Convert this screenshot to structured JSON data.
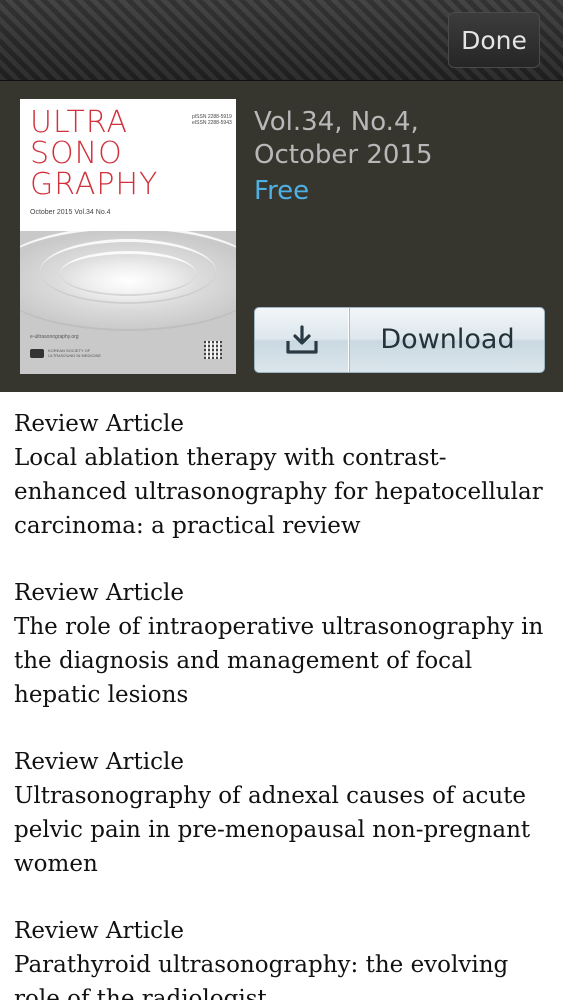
{
  "nav": {
    "done_label": "Done"
  },
  "issue": {
    "cover": {
      "title_lines": [
        "ULTRA",
        "SONO",
        "GRAPHY"
      ],
      "issn_lines": [
        "pISSN 2288-5919",
        "eISSN 2288-5943"
      ],
      "subtitle": "October 2015  Vol.34  No.4",
      "url": "e-ultrasonography.org",
      "society_lines": [
        "KOREAN SOCIETY OF",
        "ULTRASOUND IN MEDICINE"
      ],
      "title_color": "#d1313c"
    },
    "volume_line": "Vol.34, No.4,",
    "date_line": "October 2015",
    "price": "Free",
    "price_color": "#4fb0e4",
    "download_label": "Download",
    "download_icon": "download-tray-icon"
  },
  "articles": [
    {
      "kind": "Review Article",
      "title": "Local ablation therapy with contrast-enhanced ultrasonography for hepatocellular carcinoma: a practical review"
    },
    {
      "kind": "Review Article",
      "title": "The role of intraoperative ultrasonography in the diagnosis and management of focal hepatic lesions"
    },
    {
      "kind": "Review Article",
      "title": "Ultrasonography of adnexal causes of acute pelvic pain in pre-menopausal non-pregnant women"
    },
    {
      "kind": "Review Article",
      "title": "Parathyroid ultrasonography: the evolving role of the radiologist"
    }
  ]
}
